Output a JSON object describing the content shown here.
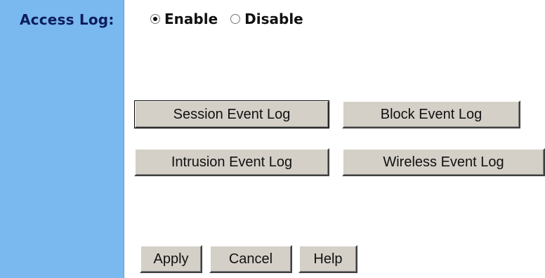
{
  "sidebar": {
    "label": "Access Log:"
  },
  "access_log": {
    "enable_label": "Enable",
    "disable_label": "Disable",
    "selected": "Enable"
  },
  "log_buttons": {
    "session": "Session Event Log",
    "block": "Block Event Log",
    "intrusion": "Intrusion Event Log",
    "wireless": "Wireless Event Log"
  },
  "actions": {
    "apply": "Apply",
    "cancel": "Cancel",
    "help": "Help"
  },
  "colors": {
    "sidebar_bg": "#7ab8f0",
    "button_bg": "#d4d0c8"
  }
}
